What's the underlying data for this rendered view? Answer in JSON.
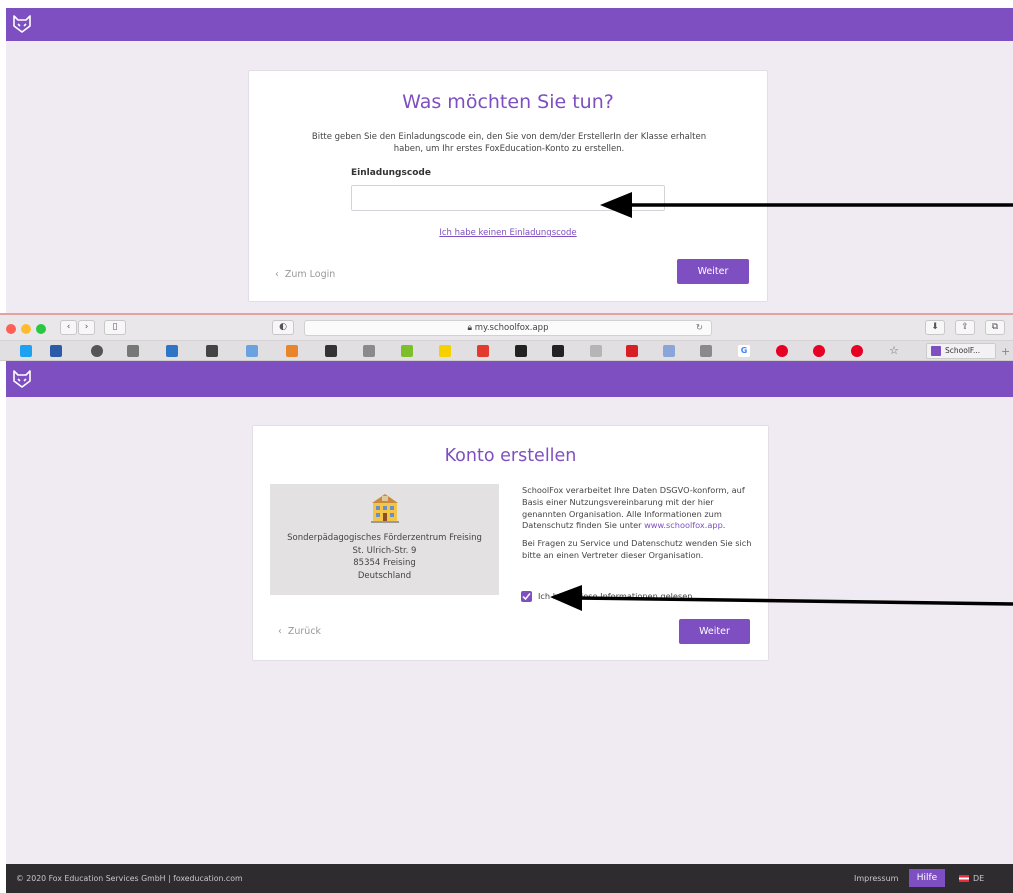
{
  "top_panel": {
    "card": {
      "title": "Was möchten Sie tun?",
      "description": "Bitte geben Sie den Einladungscode ein, den Sie von dem/der ErstellerIn der Klasse erhalten haben, um Ihr erstes FoxEducation-Konto zu erstellen.",
      "field_label": "Einladungscode",
      "field_value": "",
      "field_placeholder": "",
      "no_code_link": "Ich habe keinen Einladungscode",
      "back_label": "Zum Login",
      "next_label": "Weiter"
    }
  },
  "browser": {
    "url": "my.schoolfox.app",
    "active_tab": "SchoolF...",
    "bookmarks": [
      "twitter",
      "bm",
      "cc",
      "c",
      "o",
      "ig",
      "bm",
      "G",
      "bm",
      "A",
      "C",
      "lidl",
      "4",
      "a",
      "a",
      "A",
      "grid",
      "bm",
      "A",
      "G",
      "p",
      "p",
      "p",
      "star"
    ]
  },
  "main_panel": {
    "card": {
      "title": "Konto erstellen",
      "organisation": {
        "name": "Sonderpädagogisches Förderzentrum Freising",
        "street": "St. Ulrich-Str. 9",
        "city": "85354 Freising",
        "country": "Deutschland"
      },
      "info_text_1": "SchoolFox verarbeitet Ihre Daten DSGVO-konform, auf Basis einer Nutzungsvereinbarung mit der hier genannten Organisation. Alle Informationen zum Datenschutz finden Sie unter ",
      "info_link": "www.schoolfox.app",
      "info_text_1_end": ".",
      "info_text_2": "Bei Fragen zu Service und Datenschutz wenden Sie sich bitte an einen Vertreter dieser Organisation.",
      "consent_label": "Ich habe diese Informationen gelesen",
      "consent_checked": true,
      "back_label": "Zurück",
      "next_label": "Weiter"
    }
  },
  "footer": {
    "copyright": "© 2020 Fox Education Services GmbH | foxeducation.com",
    "impressum": "Impressum",
    "help": "Hilfe",
    "language": "DE"
  },
  "colors": {
    "brand": "#7e4fc0",
    "background": "#f0ebf2",
    "footer": "#2e2c2f"
  }
}
